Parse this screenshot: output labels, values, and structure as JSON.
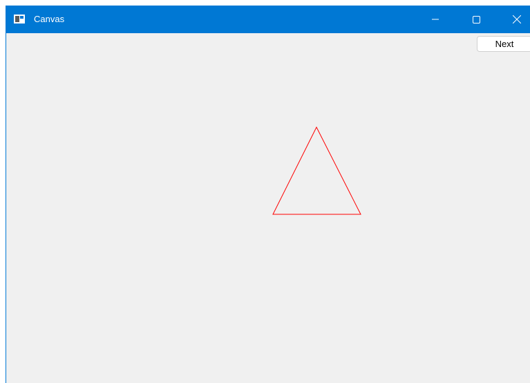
{
  "window": {
    "title": "Canvas",
    "controls": {
      "minimize_icon": "minimize-icon",
      "maximize_icon": "maximize-icon",
      "close_icon": "close-icon"
    },
    "titlebar_color": "#0078d4",
    "background_color": "#f0f0f0"
  },
  "toolbar": {
    "next_label": "Next"
  },
  "canvas": {
    "shape": "triangle",
    "stroke_color": "#ff0000"
  }
}
